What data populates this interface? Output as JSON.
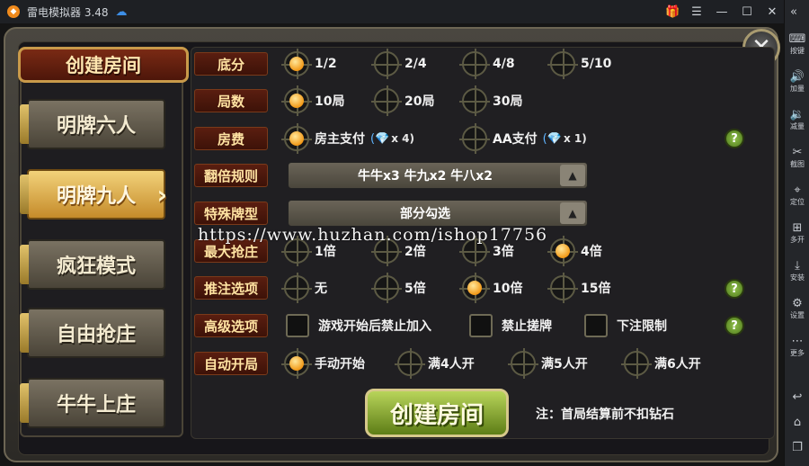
{
  "window": {
    "title": "雷电模拟器 3.48"
  },
  "sidebar": [
    {
      "icon": "keyboard-icon",
      "label": "按键"
    },
    {
      "icon": "volume-up-icon",
      "label": "加量"
    },
    {
      "icon": "volume-down-icon",
      "label": "减量"
    },
    {
      "icon": "scissors-icon",
      "label": "截图"
    },
    {
      "icon": "location-icon",
      "label": "定位"
    },
    {
      "icon": "multi-open-icon",
      "label": "多开"
    },
    {
      "icon": "install-icon",
      "label": "安装"
    },
    {
      "icon": "gear-icon",
      "label": "设置"
    },
    {
      "icon": "more-icon",
      "label": "更多"
    }
  ],
  "header": {
    "create_room": "创建房间"
  },
  "tabs": [
    "明牌六人",
    "明牌九人",
    "疯狂模式",
    "自由抢庄",
    "牛牛上庄"
  ],
  "active_tab": "明牌九人",
  "rows": {
    "base_score": {
      "label": "底分",
      "options": [
        "1/2",
        "2/4",
        "4/8",
        "5/10"
      ],
      "selected": "1/2"
    },
    "rounds": {
      "label": "局数",
      "options": [
        "10局",
        "20局",
        "30局"
      ],
      "selected": "10局"
    },
    "room_fee": {
      "label": "房费",
      "options": [
        {
          "text": "房主支付",
          "gem": "(💎",
          "mult": "x 4)"
        },
        {
          "text": "AA支付",
          "gem": "(💎",
          "mult": "x 1)"
        }
      ],
      "selected": "房主支付"
    },
    "double_rule": {
      "label": "翻倍规则",
      "value": "牛牛x3 牛九x2 牛八x2"
    },
    "special": {
      "label": "特殊牌型",
      "value": "部分勾选"
    },
    "max_banker": {
      "label": "最大抢庄",
      "options": [
        "1倍",
        "2倍",
        "3倍",
        "4倍"
      ],
      "selected": "4倍"
    },
    "push_bet": {
      "label": "推注选项",
      "options": [
        "无",
        "5倍",
        "10倍",
        "15倍"
      ],
      "selected": "10倍"
    },
    "advanced": {
      "label": "高级选项",
      "options": [
        "游戏开始后禁止加入",
        "禁止搓牌",
        "下注限制"
      ]
    },
    "auto_start": {
      "label": "自动开局",
      "options": [
        "手动开始",
        "满4人开",
        "满5人开",
        "满6人开"
      ],
      "selected": "手动开始"
    }
  },
  "help_label": "?",
  "create_button": "创建房间",
  "note": "注：首局结算前不扣钻石",
  "watermark": "https://www.huzhan.com/ishop17756"
}
